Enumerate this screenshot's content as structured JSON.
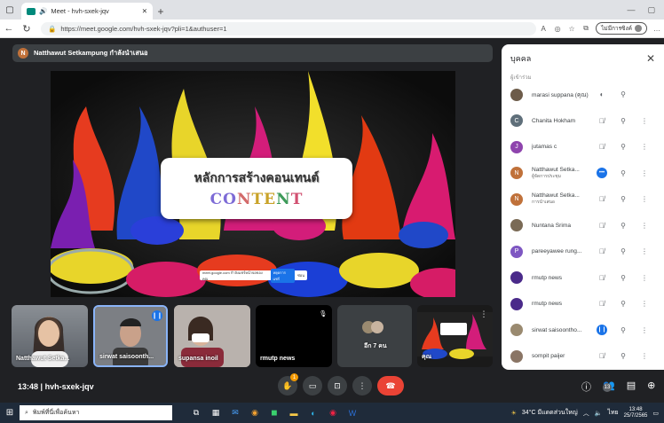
{
  "browser": {
    "tab_title": "Meet - hvh-sxek-jqv",
    "url": "https://meet.google.com/hvh-sxek-jqv?pli=1&authuser=1",
    "profile_label": "ไม่มีการซิงค์"
  },
  "presenter": {
    "initial": "N",
    "label": "Natthawut Setkampung กำลังนำเสนอ"
  },
  "slide": {
    "title": "หลักการสร้างคอนเทนต์",
    "word_parts": [
      "CO",
      "N",
      "TE",
      "N",
      "T"
    ],
    "share_text": "meet.google.com กำลังแชร์หน้าจอของคุณ",
    "stop_label": "หยุดการแชร์",
    "hide_label": "ซ่อน"
  },
  "tiles": [
    {
      "name": "Natthawut Setka..."
    },
    {
      "name": "sirwat saisoonth..."
    },
    {
      "name": "supansa inoil"
    },
    {
      "name": "rmutp news"
    },
    {
      "name": "อีก 7 คน"
    },
    {
      "name": "คุณ"
    }
  ],
  "meeting": {
    "time": "13:48",
    "code": "hvh-sxek-jqv",
    "hand_count": "1",
    "people_count": "13"
  },
  "panel": {
    "title": "บุคคล",
    "subtitle": "ผู้เข้าร่วม",
    "people": [
      {
        "name": "marasi suppana (คุณ)",
        "sub": "",
        "initial": "",
        "color": "#6d5c4a"
      },
      {
        "name": "Chanita Hokham",
        "sub": "",
        "initial": "C",
        "color": "#5f6f7a"
      },
      {
        "name": "jutamas c",
        "sub": "",
        "initial": "J",
        "color": "#8e44ad"
      },
      {
        "name": "Natthawut Setka...",
        "sub": "ผู้จัดการประชุม",
        "initial": "N",
        "color": "#c0713a"
      },
      {
        "name": "Natthawut Setka...",
        "sub": "การนำเสนอ",
        "initial": "N",
        "color": "#c0713a"
      },
      {
        "name": "Nuntana Srima",
        "sub": "",
        "initial": "",
        "color": "#7a6a55"
      },
      {
        "name": "pareeyawee rung...",
        "sub": "",
        "initial": "P",
        "color": "#7e57c2"
      },
      {
        "name": "rmutp news",
        "sub": "",
        "initial": "",
        "color": "#4a2a8a"
      },
      {
        "name": "rmutp news",
        "sub": "",
        "initial": "",
        "color": "#4a2a8a"
      },
      {
        "name": "sirwat saisoontho...",
        "sub": "",
        "initial": "",
        "color": "#9a8a70"
      },
      {
        "name": "sompit paijer",
        "sub": "",
        "initial": "",
        "color": "#8a7565"
      }
    ]
  },
  "taskbar": {
    "search_placeholder": "พิมพ์ที่นี่เพื่อค้นหา",
    "weather": "34°C มีแดดส่วนใหญ่",
    "lang": "ไทย",
    "time": "13:48",
    "date": "25/7/2565"
  }
}
